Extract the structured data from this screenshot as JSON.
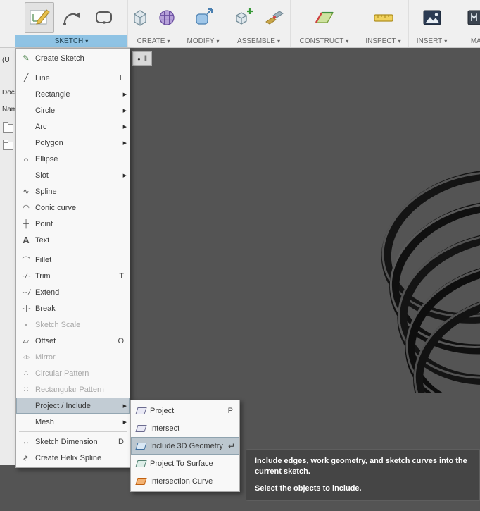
{
  "toolbar": {
    "groups": [
      {
        "label": "SKETCH",
        "active": true
      },
      {
        "label": "CREATE"
      },
      {
        "label": "MODIFY"
      },
      {
        "label": "ASSEMBLE"
      },
      {
        "label": "CONSTRUCT"
      },
      {
        "label": "INSPECT"
      },
      {
        "label": "INSERT"
      },
      {
        "label": "MAKE"
      }
    ]
  },
  "browser_strip": {
    "items": [
      "(U",
      "Doc",
      "Nam"
    ]
  },
  "sketch_menu": {
    "items": [
      {
        "label": "Create Sketch"
      },
      {
        "label": "Line",
        "shortcut": "L"
      },
      {
        "label": "Rectangle",
        "submenu": true
      },
      {
        "label": "Circle",
        "submenu": true
      },
      {
        "label": "Arc",
        "submenu": true
      },
      {
        "label": "Polygon",
        "submenu": true
      },
      {
        "label": "Ellipse"
      },
      {
        "label": "Slot",
        "submenu": true
      },
      {
        "label": "Spline"
      },
      {
        "label": "Conic curve"
      },
      {
        "label": "Point"
      },
      {
        "label": "Text"
      },
      {
        "label": "Fillet"
      },
      {
        "label": "Trim",
        "shortcut": "T"
      },
      {
        "label": "Extend"
      },
      {
        "label": "Break"
      },
      {
        "label": "Sketch Scale",
        "disabled": true
      },
      {
        "label": "Offset",
        "shortcut": "O"
      },
      {
        "label": "Mirror",
        "disabled": true
      },
      {
        "label": "Circular Pattern",
        "disabled": true
      },
      {
        "label": "Rectangular Pattern",
        "disabled": true
      },
      {
        "label": "Project / Include",
        "submenu": true,
        "highlighted": true
      },
      {
        "label": "Mesh",
        "submenu": true
      },
      {
        "label": "Sketch Dimension",
        "shortcut": "D"
      },
      {
        "label": "Create Helix Spline"
      }
    ]
  },
  "project_submenu": {
    "items": [
      {
        "label": "Project",
        "shortcut": "P"
      },
      {
        "label": "Intersect"
      },
      {
        "label": "Include 3D Geometry",
        "highlighted": true
      },
      {
        "label": "Project To Surface"
      },
      {
        "label": "Intersection Curve"
      }
    ]
  },
  "tooltip": {
    "line1": "Include edges, work geometry, and sketch curves into the current sketch.",
    "line2": "Select the objects to include."
  },
  "icons": {
    "caret": "▾",
    "submenu_arrow": "▶",
    "return_arrow": "↵",
    "create_sketch": "✎",
    "line": "╱",
    "ellipse": "○",
    "spline": "∿",
    "conic_curve": "◠",
    "point": "┼",
    "text": "A",
    "fillet": "⌒",
    "trim": "-/-",
    "extend": "--/",
    "break": "-|-",
    "sketch_scale": "▪",
    "offset": "▱",
    "mirror": "◁▷",
    "circular_pattern": "∴",
    "rectangular_pattern": "∷",
    "sketch_dimension": "↔",
    "helix": "∿",
    "mini_dot": "●",
    "mini_bars": "‖"
  },
  "colors": {
    "accent_blue": "#8fc3e4",
    "viewport_bg": "#545454",
    "menu_highlight": "#c2ccd4",
    "tooltip_bg": "#454545"
  }
}
